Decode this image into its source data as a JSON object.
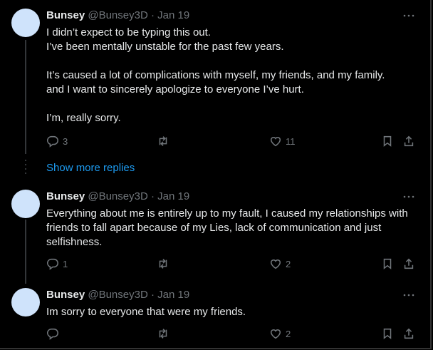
{
  "tweets": [
    {
      "name": "Bunsey",
      "handle": "@Bunsey3D",
      "separator": "·",
      "date": "Jan 19",
      "body": [
        "I didn’t expect to be typing this out.",
        "I’ve been mentally unstable for the past few years.",
        "",
        "It’s caused a lot of complications with myself, my friends, and my family.",
        "and I want to sincerely apologize to everyone I’ve hurt.",
        "",
        "I’m, really sorry."
      ],
      "replies": "3",
      "retweets": "",
      "likes": "11"
    },
    {
      "name": "Bunsey",
      "handle": "@Bunsey3D",
      "separator": "·",
      "date": "Jan 19",
      "body": [
        "Everything about me is entirely up to my fault, I caused my relationships with",
        "friends to fall apart because of my Lies, lack of communication and just",
        "selfishness."
      ],
      "replies": "1",
      "retweets": "",
      "likes": "2"
    },
    {
      "name": "Bunsey",
      "handle": "@Bunsey3D",
      "separator": "·",
      "date": "Jan 19",
      "body": [
        "Im sorry to everyone that were my friends."
      ],
      "replies": "",
      "retweets": "",
      "likes": "2"
    }
  ],
  "show_more_replies": "Show more replies",
  "icons": [
    "more-icon",
    "reply-icon",
    "retweet-icon",
    "like-icon",
    "bookmark-icon",
    "share-icon"
  ],
  "colors": {
    "background": "#000000",
    "text": "#e7e9ea",
    "muted": "#71767b",
    "link": "#1d9bf0",
    "avatar": "#cfe3fb"
  }
}
